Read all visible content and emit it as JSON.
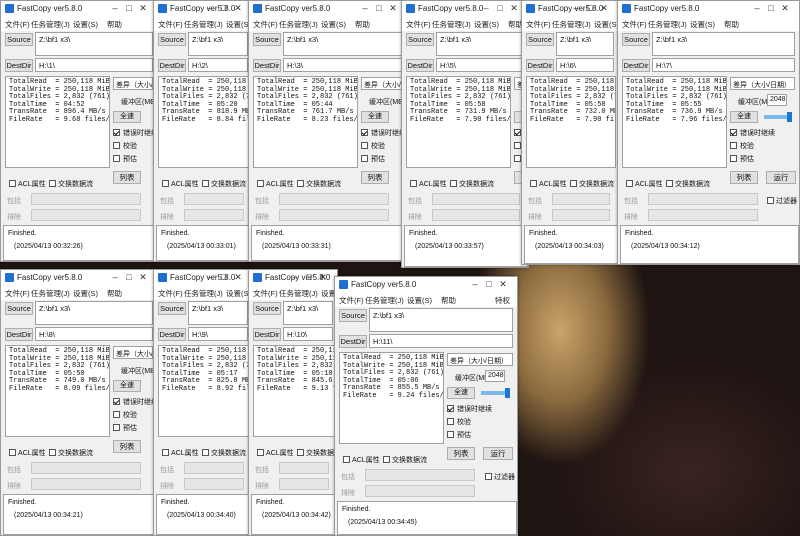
{
  "app": {
    "title": "FastCopy ver5.8.0",
    "menu": [
      "文件(F)",
      "任务管理(J)",
      "设置(S)",
      "帮助"
    ],
    "menu_full": [
      "文件(F)",
      "任务管理(J)",
      "设置(S)",
      "帮助",
      "特权"
    ],
    "source_label": "Source",
    "destdir_label": "DestDir",
    "source_value": "Z:\\bf1 x3\\",
    "mode_value": "差异（大小/日期）",
    "buffer_label": "缓冲区(MB)",
    "buffer_value": "2048",
    "fullspeed_label": "全速",
    "opt_error_continue": "错误时继续",
    "opt_verify": "校验",
    "opt_estimate": "预估",
    "list_button": "列表",
    "run_button": "运行",
    "acl_label": "ACL属性",
    "altstream_label": "交换数据流",
    "include_label": "包括",
    "exclude_label": "排除",
    "filter_label": "过滤器",
    "finished_text": "Finished."
  },
  "windows": [
    {
      "dest": "H:\\1\\",
      "read": "250,118 MiB",
      "write": "250,118 MiB",
      "files": "2,832 (761)",
      "time": "04:52",
      "rate": "896.4 MB/s",
      "frate": "9.68 files/s",
      "ts": "(2025/04/13 00:32:26)"
    },
    {
      "dest": "H:\\2\\",
      "read": "250,118 MiB",
      "write": "250,118 MiB",
      "files": "2,832 (761)",
      "time": "05:20",
      "rate": "818.9 MB/s",
      "frate": "8.84 files/s",
      "ts": "(2025/04/13 00:33:01)"
    },
    {
      "dest": "H:\\3\\",
      "read": "250,118 MiB",
      "write": "250,118 MiB",
      "files": "2,832 (761)",
      "time": "05:44",
      "rate": "761.7 MB/s",
      "frate": "8.23 files/s",
      "ts": "(2025/04/13 00:33:31)"
    },
    {
      "dest": "H:\\5\\",
      "read": "250,118 MiB",
      "write": "250,118 MiB",
      "files": "2,832 (761)",
      "time": "05:58",
      "rate": "731.9 MB/s",
      "frate": "7.90 files/s",
      "ts": "(2025/04/13 00:33:57)"
    },
    {
      "dest": "H:\\6\\",
      "read": "250,118 MiB",
      "write": "250,118 MiB",
      "files": "2,832 (761)",
      "time": "05:58",
      "rate": "732.0 MB/s",
      "frate": "7.90 files/s",
      "ts": "(2025/04/13 00:34:03)"
    },
    {
      "dest": "H:\\7\\",
      "read": "250,118 MiB",
      "write": "250,118 MiB",
      "files": "2,832 (761)",
      "time": "05:55",
      "rate": "736.9 MB/s",
      "frate": "7.96 files/s",
      "ts": "(2025/04/13 00:34:12)"
    },
    {
      "dest": "H:\\8\\",
      "read": "250,118 MiB",
      "write": "250,118 MiB",
      "files": "2,832 (761)",
      "time": "05:50",
      "rate": "749.0 MB/s",
      "frate": "8.09 files/s",
      "ts": "(2025/04/13 00:34:21)"
    },
    {
      "dest": "H:\\9\\",
      "read": "250,118 MiB",
      "write": "250,118 MiB",
      "files": "2,832 (761)",
      "time": "05:17",
      "rate": "825.8 MB/s",
      "frate": "8.92 files/s",
      "ts": "(2025/04/13 00:34:40)"
    },
    {
      "dest": "H:\\10\\",
      "read": "250,118 MiB",
      "write": "250,118 MiB",
      "files": "2,832 (761)",
      "time": "05:10",
      "rate": "845.6 MB/s",
      "frate": "9.13 files/s",
      "ts": "(2025/04/13 00:34:42)"
    },
    {
      "dest": "H:\\11\\",
      "read": "250,118 MiB",
      "write": "250,118 MiB",
      "files": "2,832 (761)",
      "time": "05:06",
      "rate": "855.5 MB/s",
      "frate": "9.24 files/s",
      "ts": "(2025/04/13 00:34:45)"
    }
  ]
}
